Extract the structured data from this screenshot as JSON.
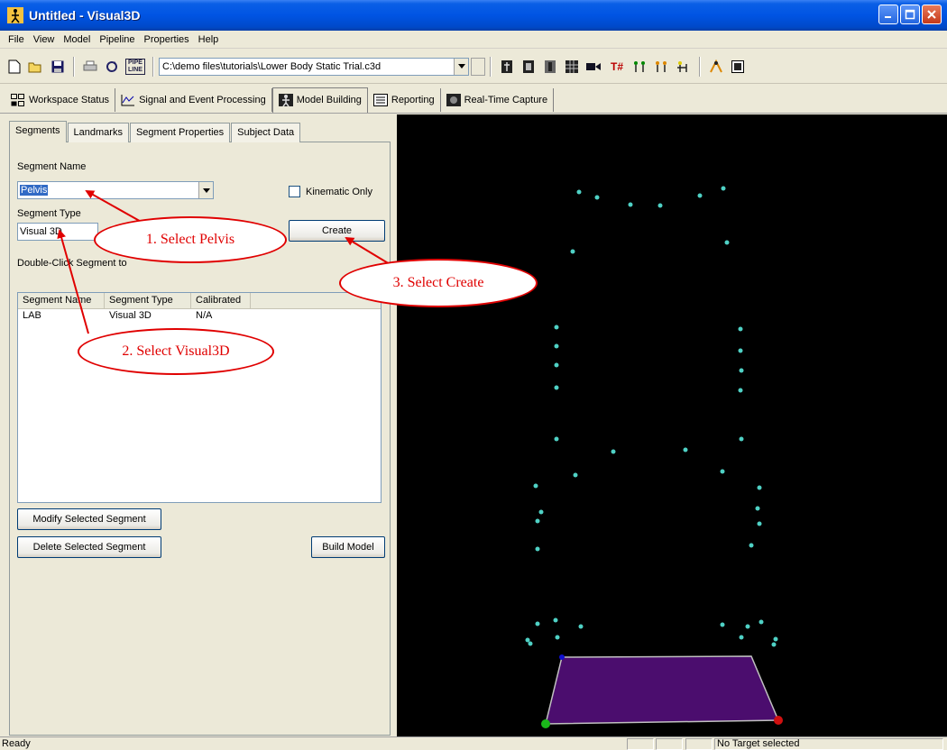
{
  "window": {
    "title": "Untitled - Visual3D"
  },
  "menu": [
    "File",
    "View",
    "Model",
    "Pipeline",
    "Properties",
    "Help"
  ],
  "toolbar": {
    "file_path": "C:\\demo files\\tutorials\\Lower Body Static Trial.c3d",
    "pipe_label": "PIPE\nLINE",
    "t_label": "T#"
  },
  "modules": [
    {
      "label": "Workspace Status"
    },
    {
      "label": "Signal and Event Processing"
    },
    {
      "label": "Model Building"
    },
    {
      "label": "Reporting"
    },
    {
      "label": "Real-Time Capture"
    }
  ],
  "subtabs": [
    "Segments",
    "Landmarks",
    "Segment Properties",
    "Subject Data"
  ],
  "form": {
    "segment_name_label": "Segment Name",
    "segment_name_value": "Pelvis",
    "kinematic_only_label": "Kinematic Only",
    "segment_type_label": "Segment Type",
    "segment_type_value": "Visual 3D",
    "create_label": "Create",
    "double_click_label": "Double-Click Segment to",
    "modify_label": "Modify Selected Segment",
    "delete_label": "Delete Selected Segment",
    "build_label": "Build Model"
  },
  "table": {
    "columns": [
      "Segment Name",
      "Segment Type",
      "Calibrated"
    ],
    "rows": [
      [
        "LAB",
        "Visual 3D",
        "N/A"
      ]
    ]
  },
  "annotations": {
    "step1": "1. Select Pelvis",
    "step2": "2. Select Visual3D",
    "step3": "3. Select Create"
  },
  "status": {
    "ready": "Ready",
    "target": "No Target selected"
  },
  "colors": {
    "accent_red": "#e00000",
    "platform": "#4b0d6e",
    "marker": "#4fd1c5"
  }
}
